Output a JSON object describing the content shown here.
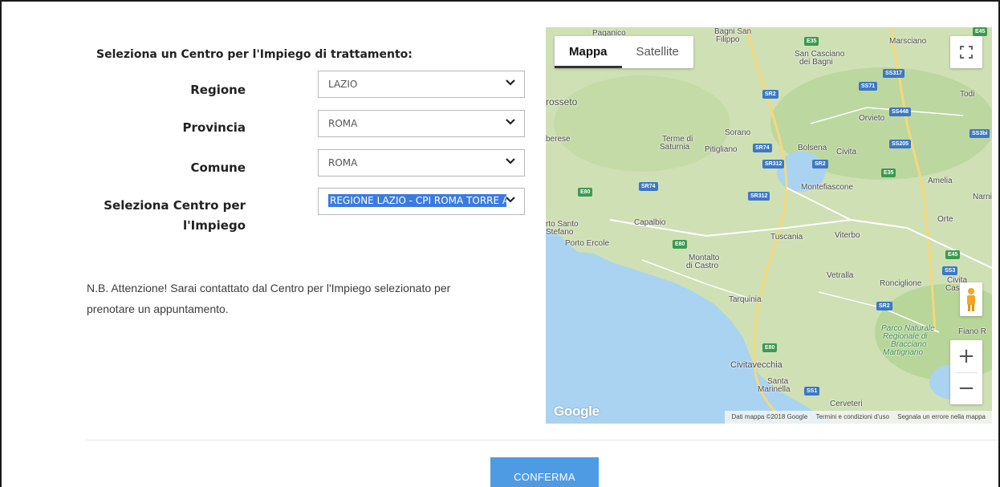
{
  "form": {
    "heading": "Seleziona un Centro per l'Impiego di trattamento:",
    "regione": {
      "label": "Regione",
      "value": "LAZIO"
    },
    "provincia": {
      "label": "Provincia",
      "value": "ROMA"
    },
    "comune": {
      "label": "Comune",
      "value": "ROMA"
    },
    "centro": {
      "label_line1": "Seleziona Centro per",
      "label_line2": "l'Impiego",
      "value": "REGIONE LAZIO - CPI ROMA TORRE A"
    },
    "note_line1": "N.B. Attenzione! Sarai contattato dal Centro per l'Impiego selezionato per",
    "note_line2": "prenotare un appuntamento.",
    "confirm_label": "CONFERMA"
  },
  "map": {
    "tabs": [
      "Mappa",
      "Satellite"
    ],
    "active_tab": "Mappa",
    "zoom_in": "+",
    "zoom_out": "−",
    "logo": "Google",
    "attribution": [
      "Dati mappa ©2018 Google",
      "Termini e condizioni d'uso",
      "Segnala un errore nella mappa"
    ],
    "places": [
      "Paganico",
      "Bagni San",
      "Filippo",
      "San Casciano",
      "dei Bagni",
      "Marsciano",
      "rosseto",
      "Todi",
      "Orvieto",
      "berese",
      "Terme di",
      "Saturnia",
      "Sorano",
      "Pitigliano",
      "Bolsena",
      "Civita",
      "Amelia",
      "Narni",
      "Montefiascone",
      "Orte",
      "rto Santo",
      "Stefano",
      "Capalbio",
      "Porto Ercole",
      "Tuscania",
      "Viterbo",
      "Montalto",
      "di Castro",
      "Vetralla",
      "Ronciglione",
      "Civita",
      "Castella",
      "Tarquinia",
      "Parco Naturale",
      "Regionale di",
      "Bracciano",
      "Martignano",
      "Fiano R",
      "Civitavecchia",
      "Santa",
      "Marinella",
      "Cerveteri"
    ],
    "roads": [
      "E45",
      "E35",
      "SS71",
      "SS317",
      "SR2",
      "SS448",
      "SR74",
      "SS205",
      "SR312",
      "SR2",
      "E35",
      "SR74",
      "SR312",
      "E80",
      "E80",
      "E45",
      "SS3",
      "SR2",
      "E80",
      "SS1",
      "SS3bi"
    ],
    "colors": {
      "land": "#cfe0b5",
      "sea": "#aad3f2",
      "accent": "#3b7be0",
      "button": "#4e9be4"
    }
  }
}
